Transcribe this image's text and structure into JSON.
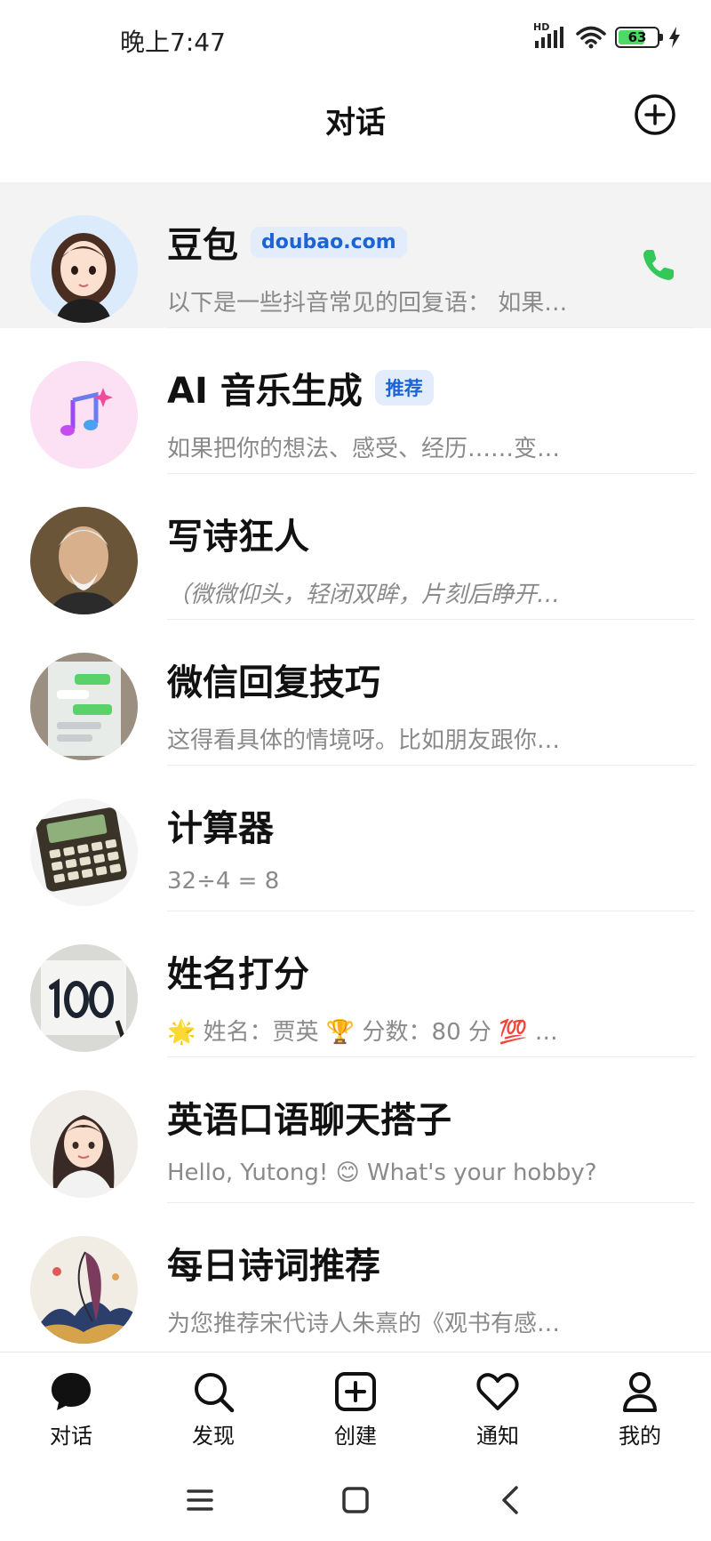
{
  "status_bar": {
    "time": "晚上7:47",
    "network": "HD",
    "battery": "63"
  },
  "header": {
    "title": "对话"
  },
  "chats": [
    {
      "name": "豆包",
      "tag": "doubao.com",
      "preview": "以下是一些抖音常见的回复语： 如果…"
    },
    {
      "name": "AI 音乐生成",
      "tag": "推荐",
      "preview": "如果把你的想法、感受、经历……变…"
    },
    {
      "name": "写诗狂人",
      "preview": "（微微仰头，轻闭双眸，片刻后睁开…"
    },
    {
      "name": "微信回复技巧",
      "preview": "这得看具体的情境呀。比如朋友跟你…"
    },
    {
      "name": "计算器",
      "preview": "32÷4 = 8"
    },
    {
      "name": "姓名打分",
      "preview": "🌟 姓名：贾英 🏆 分数：80 分 💯 …"
    },
    {
      "name": "英语口语聊天搭子",
      "preview": "Hello, Yutong! 😊 What's your hobby?"
    },
    {
      "name": "每日诗词推荐",
      "preview": "为您推荐宋代诗人朱熹的《观书有感…"
    }
  ],
  "nav": [
    {
      "label": "对话",
      "icon": "chat-bubble-icon"
    },
    {
      "label": "发现",
      "icon": "search-icon"
    },
    {
      "label": "创建",
      "icon": "create-plus-icon"
    },
    {
      "label": "通知",
      "icon": "heart-icon"
    },
    {
      "label": "我的",
      "icon": "person-icon"
    }
  ],
  "colors": {
    "tag_text": "#1b64d8",
    "tag_bg": "#e3ecfb",
    "phone": "#34c759",
    "active_row": "#f3f3f3"
  }
}
